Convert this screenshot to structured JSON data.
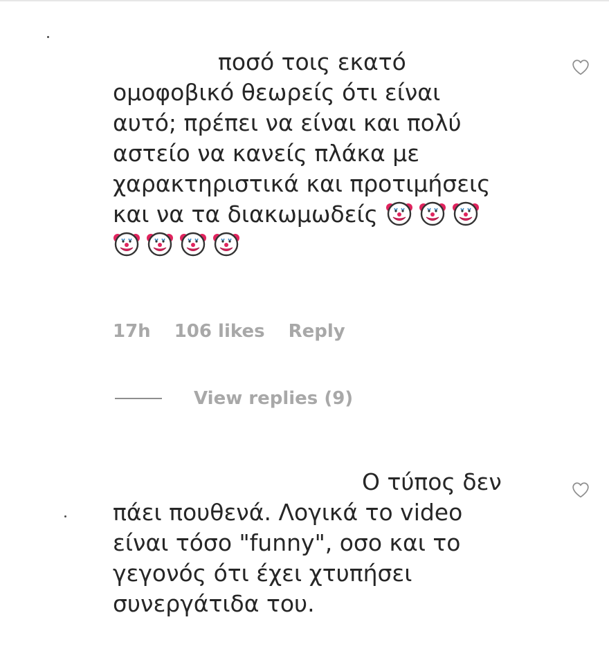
{
  "comments": [
    {
      "lines": [
        "ποσό τοις εκατό",
        "ομοφοβικό θεωρείς ότι είναι",
        "αυτό; πρέπει να είναι και πολύ",
        "αστείο να κανείς πλάκα με",
        "χαρακτηριστικά και προτιμήσεις",
        "και να τα διακωμωδείς"
      ],
      "emoji_name": "clown-face",
      "emoji_count": 7,
      "time": "17h",
      "likes": "106 likes",
      "reply_label": "Reply",
      "view_replies": "View replies (9)",
      "liked": false
    },
    {
      "lines": [
        "Ο τύπος δεν",
        "πάει πουθενά. Λογικά το video",
        "είναι τόσο \"funny\", οσο και το",
        "γεγονός ότι έχει χτυπήσει",
        "συνεργάτιδα του."
      ],
      "liked": false
    }
  ],
  "icons": {
    "like": "heart-outline-icon",
    "emoji": "clown-face-emoji"
  },
  "colors": {
    "text": "#262626",
    "meta": "#a8a8a8",
    "heart_stroke": "#8e8e8e"
  }
}
